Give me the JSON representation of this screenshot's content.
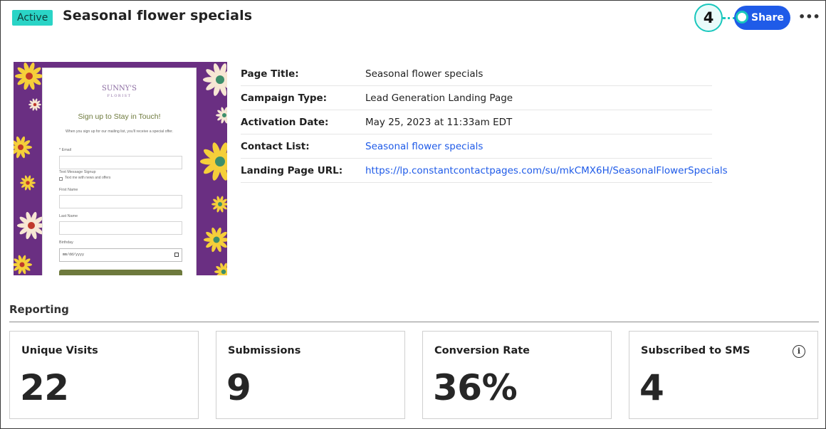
{
  "header": {
    "status": "Active",
    "title": "Seasonal flower specials",
    "step_number": "4",
    "share_label": "Share",
    "more_label": "•••"
  },
  "preview": {
    "brand_name": "SUNNY'S",
    "brand_sub": "FLORIST",
    "heading": "Sign up to Stay in Touch!",
    "intro": "When you sign up for our mailing list, you'll receive a special offer.",
    "fields": {
      "email_label": "* Email",
      "sms_label": "Text Message Signup",
      "sms_checkbox_label": "Text me with news and offers",
      "first_name_label": "First Name",
      "last_name_label": "Last Name",
      "birthday_label": "Birthday",
      "birthday_placeholder": "mm/dd/yyyy"
    },
    "colors": {
      "background": "#6a2f82",
      "petal": "#f5cf3a",
      "accent": "#6e7a3d"
    }
  },
  "details": [
    {
      "label": "Page Title:",
      "value": "Seasonal flower specials"
    },
    {
      "label": "Campaign Type:",
      "value": "Lead Generation Landing Page"
    },
    {
      "label": "Activation Date:",
      "value": "May 25, 2023 at 11:33am EDT"
    },
    {
      "label": "Contact List:",
      "value": "Seasonal flower specials"
    },
    {
      "label": "Landing Page URL:",
      "value": "https://lp.constantcontactpages.com/su/mkCMX6H/SeasonalFlowerSpecials"
    }
  ],
  "reporting": {
    "title": "Reporting",
    "metrics": [
      {
        "label": "Unique Visits",
        "value": "22"
      },
      {
        "label": "Submissions",
        "value": "9"
      },
      {
        "label": "Conversion Rate",
        "value": "36%"
      },
      {
        "label": "Subscribed to SMS",
        "value": "4",
        "info_icon": "info-icon"
      }
    ]
  },
  "colors": {
    "badge": "#2ad4c6",
    "primary": "#1f5be8",
    "callout": "#19c7bd"
  }
}
